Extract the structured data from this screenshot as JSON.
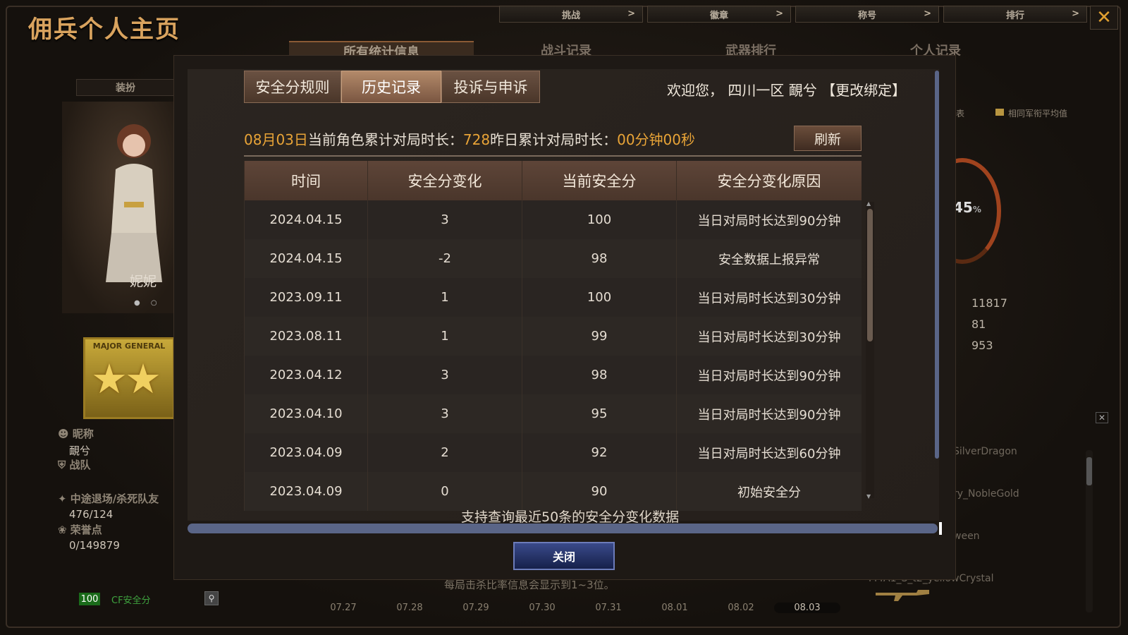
{
  "background": {
    "page_title": "佣兵个人主页",
    "top_nav": [
      {
        "label": "挑战",
        "arrow": ">"
      },
      {
        "label": "徽章",
        "arrow": ">"
      },
      {
        "label": "称号",
        "arrow": ">"
      },
      {
        "label": "排行",
        "arrow": ">"
      }
    ],
    "close_icon": "✕",
    "tabs": [
      "所有统计信息",
      "战斗记录",
      "武器排行",
      "个人记录"
    ],
    "equip_button": "装扮",
    "character_name": "妮妮",
    "rank_badge_text": "MAJOR GENERAL",
    "profile": {
      "nickname_label": "昵称",
      "nickname_value": "靦兮",
      "clan_label": "战队",
      "escape_label": "中途退场/杀死队友",
      "escape_value": "476/124",
      "honor_label": "荣誉点",
      "honor_value": "0/149879"
    },
    "safety_score_value": "100",
    "safety_score_label": "CF安全分",
    "bottom_hint": "每局击杀比率信息会显示到1~3位。",
    "dates": [
      "07.27",
      "07.28",
      "07.29",
      "07.30",
      "07.31",
      "08.01",
      "08.02",
      "08.03"
    ],
    "right_panel": {
      "legend_a": "的图表",
      "legend_b": "相同军衔平均值",
      "gauge_value": "45",
      "gauge_unit": "%",
      "stats": [
        "11817",
        "81",
        "953"
      ],
      "players": [
        "SilverDragon",
        "ry_NobleGold",
        "ween",
        "M4A1_S_t2_yellowCrystal"
      ]
    }
  },
  "modal": {
    "tabs": [
      {
        "label": "安全分规则",
        "active": false
      },
      {
        "label": "历史记录",
        "active": true
      },
      {
        "label": "投诉与申诉",
        "active": false
      }
    ],
    "welcome": "欢迎您， 四川一区 靦兮 【更改绑定】",
    "summary": {
      "date": "08月03日",
      "label_current": "当前角色累计对局时长：",
      "current_value": "728",
      "label_yesterday": "昨日累计对局时长：",
      "yesterday_value": "00分钟00秒"
    },
    "refresh_label": "刷新",
    "table": {
      "headers": [
        "时间",
        "安全分变化",
        "当前安全分",
        "安全分变化原因"
      ],
      "rows": [
        [
          "2024.04.15",
          "3",
          "100",
          "当日对局时长达到90分钟"
        ],
        [
          "2024.04.15",
          "-2",
          "98",
          "安全数据上报异常"
        ],
        [
          "2023.09.11",
          "1",
          "100",
          "当日对局时长达到30分钟"
        ],
        [
          "2023.08.11",
          "1",
          "99",
          "当日对局时长达到30分钟"
        ],
        [
          "2023.04.12",
          "3",
          "98",
          "当日对局时长达到90分钟"
        ],
        [
          "2023.04.10",
          "3",
          "95",
          "当日对局时长达到90分钟"
        ],
        [
          "2023.04.09",
          "2",
          "92",
          "当日对局时长达到60分钟"
        ],
        [
          "2023.04.09",
          "0",
          "90",
          "初始安全分"
        ]
      ]
    },
    "hint": "支持查询最近50条的安全分变化数据",
    "close_label": "关闭"
  }
}
